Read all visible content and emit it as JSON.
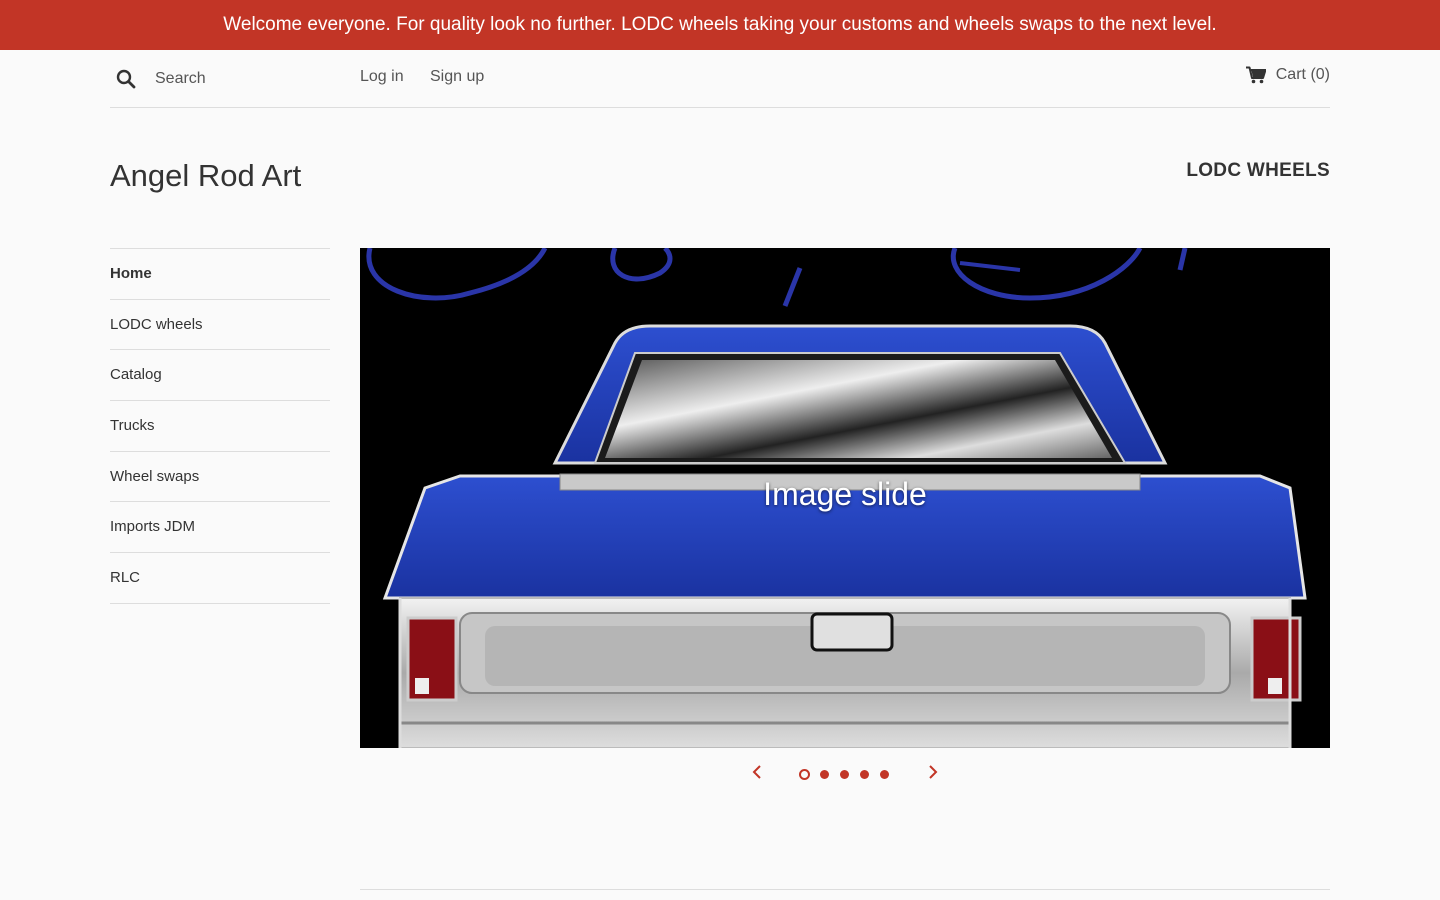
{
  "announcement": {
    "text": "Welcome everyone. For quality look no further. LODC wheels taking your customs and wheels swaps to the next level.",
    "background_color": "#c23526"
  },
  "topbar": {
    "search_placeholder": "Search",
    "search_icon": "search-icon",
    "login_label": "Log in",
    "signup_label": "Sign up",
    "cart_label": "Cart",
    "cart_count": "(0)",
    "cart_icon": "cart-icon"
  },
  "header": {
    "site_title": "Angel Rod Art",
    "featured_link": "LODC WHEELS"
  },
  "sidebar": {
    "items": [
      {
        "label": "Home"
      },
      {
        "label": "LODC wheels"
      },
      {
        "label": "Catalog"
      },
      {
        "label": "Trucks"
      },
      {
        "label": "Wheel swaps"
      },
      {
        "label": "Imports JDM"
      },
      {
        "label": "RLC"
      }
    ],
    "active_index": 0
  },
  "slideshow": {
    "caption": "Image slide",
    "slide_count": 5,
    "active_slide": 1,
    "prev_icon": "chevron-left-icon",
    "next_icon": "chevron-right-icon"
  },
  "colors": {
    "accent": "#c23526",
    "truck_blue": "#1f3db0",
    "text": "#333333"
  }
}
